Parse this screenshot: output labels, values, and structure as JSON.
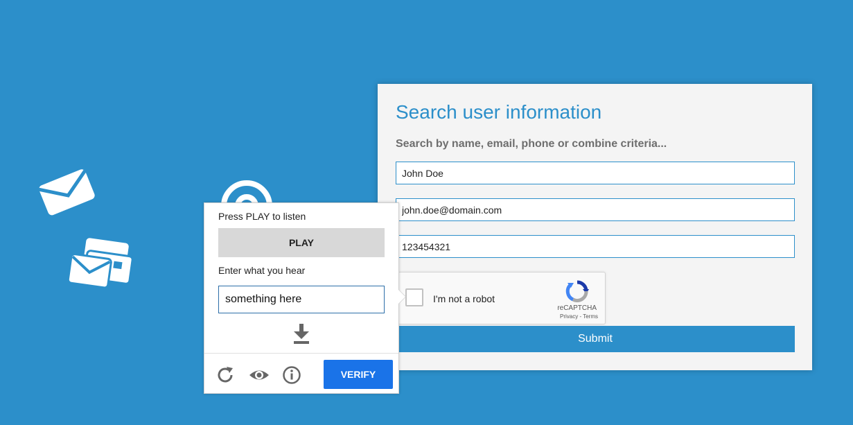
{
  "form": {
    "title": "Search user information",
    "subtitle": "Search by name, email, phone or combine criteria...",
    "name_value": "John Doe",
    "email_value": "john.doe@domain.com",
    "phone_value": "123454321",
    "submit_label": "Submit"
  },
  "recaptcha": {
    "label": "I'm not a robot",
    "brand": "reCAPTCHA",
    "links": "Privacy - Terms"
  },
  "audio_challenge": {
    "instruction": "Press PLAY to listen",
    "play_label": "PLAY",
    "enter_prompt": "Enter what you hear",
    "response_value": "something here",
    "verify_label": "VERIFY"
  },
  "icons": {
    "decorations": [
      "envelope-icon",
      "envelopes-stack-icon",
      "at-sign-icon"
    ],
    "audio_controls": [
      "download-icon",
      "reload-icon",
      "eye-icon",
      "info-icon"
    ]
  },
  "colors": {
    "background": "#2c8fca",
    "accent": "#2c8fca",
    "verify_button": "#1a73e8",
    "card_background": "#f4f4f4"
  }
}
